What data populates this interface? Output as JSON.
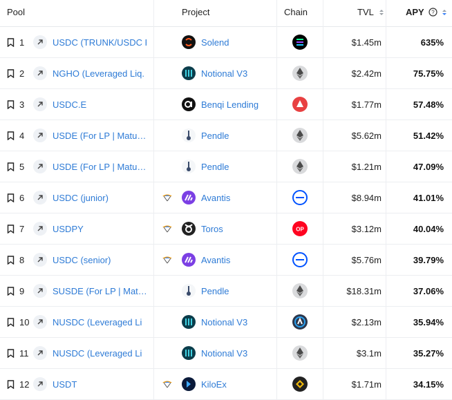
{
  "headers": {
    "pool": "Pool",
    "project": "Project",
    "chain": "Chain",
    "tvl": "TVL",
    "apy": "APY"
  },
  "rows": [
    {
      "rank": "1",
      "pool": "USDC (TRUNK/USDC F",
      "project": "Solend",
      "chain": "solana",
      "tvl": "$1.45m",
      "apy": "635%",
      "reward": false,
      "logo": "solend"
    },
    {
      "rank": "2",
      "pool": "NGHO (Leveraged Liq.",
      "project": "Notional V3",
      "chain": "ethereum",
      "tvl": "$2.42m",
      "apy": "75.75%",
      "reward": false,
      "logo": "notional"
    },
    {
      "rank": "3",
      "pool": "USDC.E",
      "project": "Benqi Lending",
      "chain": "avalanche",
      "tvl": "$1.77m",
      "apy": "57.48%",
      "reward": false,
      "logo": "benqi"
    },
    {
      "rank": "4",
      "pool": "USDE (For LP | Matu…",
      "project": "Pendle",
      "chain": "ethereum",
      "tvl": "$5.62m",
      "apy": "51.42%",
      "reward": false,
      "logo": "pendle"
    },
    {
      "rank": "5",
      "pool": "USDE (For LP | Matu…",
      "project": "Pendle",
      "chain": "ethereum",
      "tvl": "$1.21m",
      "apy": "47.09%",
      "reward": false,
      "logo": "pendle"
    },
    {
      "rank": "6",
      "pool": "USDC (junior)",
      "project": "Avantis",
      "chain": "base",
      "tvl": "$8.94m",
      "apy": "41.01%",
      "reward": true,
      "logo": "avantis"
    },
    {
      "rank": "7",
      "pool": "USDPY",
      "project": "Toros",
      "chain": "optimism",
      "tvl": "$3.12m",
      "apy": "40.04%",
      "reward": true,
      "logo": "toros"
    },
    {
      "rank": "8",
      "pool": "USDC (senior)",
      "project": "Avantis",
      "chain": "base",
      "tvl": "$5.76m",
      "apy": "39.79%",
      "reward": true,
      "logo": "avantis"
    },
    {
      "rank": "9",
      "pool": "SUSDE (For LP | Mat…",
      "project": "Pendle",
      "chain": "ethereum",
      "tvl": "$18.31m",
      "apy": "37.06%",
      "reward": false,
      "logo": "pendle"
    },
    {
      "rank": "10",
      "pool": "NUSDC (Leveraged Li",
      "project": "Notional V3",
      "chain": "arbitrum",
      "tvl": "$2.13m",
      "apy": "35.94%",
      "reward": false,
      "logo": "notional"
    },
    {
      "rank": "11",
      "pool": "NUSDC (Leveraged Li",
      "project": "Notional V3",
      "chain": "ethereum",
      "tvl": "$3.1m",
      "apy": "35.27%",
      "reward": false,
      "logo": "notional"
    },
    {
      "rank": "12",
      "pool": "USDT",
      "project": "KiloEx",
      "chain": "bsc",
      "tvl": "$1.71m",
      "apy": "34.15%",
      "reward": true,
      "logo": "kiloex"
    }
  ],
  "colors": {
    "link": "#2e7bd6",
    "accent": "#3b82f6"
  }
}
